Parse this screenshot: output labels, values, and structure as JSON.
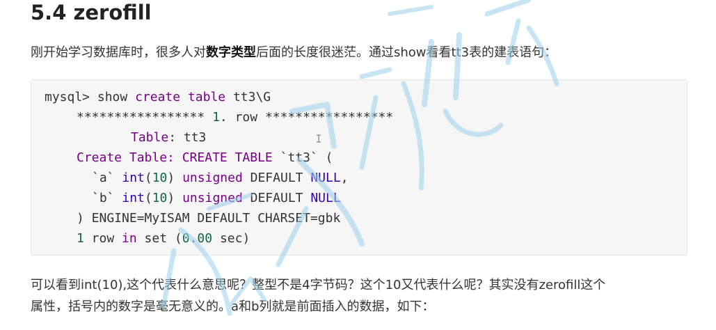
{
  "heading": "5.4 zerofill",
  "intro": {
    "before": "刚开始学习数据库时，很多人对",
    "bold": "数字类型",
    "after": "后面的长度很迷茫。通过show看看tt3表的建表语句："
  },
  "code": {
    "prompt": "mysql> ",
    "cmd_show": "show",
    "cmd_create": "create",
    "cmd_table": "table",
    "cmd_rest": " tt3\\G",
    "row_divider_left": "***************** ",
    "row_number": "1",
    "row_label": ". row ",
    "row_divider_right": "*****************",
    "table_label": "Table",
    "table_value": ": tt3",
    "create_label": "Create Table",
    "create_kw": ": CREATE TABLE ",
    "create_rest": "`tt3` (",
    "col_a_name": "`a` ",
    "col_b_name": "`b` ",
    "col_type": "int",
    "col_len_open": "(",
    "col_len": "10",
    "col_len_close": ") ",
    "col_unsigned": "unsigned",
    "col_default": " DEFAULT ",
    "col_null": "NULL",
    "col_comma": ",",
    "engine_line": ") ENGINE=MyISAM DEFAULT CHARSET=gbk",
    "result_count": "1",
    "result_row": " row ",
    "result_in": "in",
    "result_set": " set ",
    "result_time_open": "(",
    "result_time": "0.00",
    "result_time_close": " sec)"
  },
  "body": {
    "line1": "可以看到int(10),这个代表什么意思呢？整型不是4字节码？这个10又代表什么呢？其实没有zerofill这个",
    "line2": "属性，括号内的数字是毫无意义的。a和b列就是前面插入的数据，如下："
  },
  "watermark_color": "#9ad0ee"
}
